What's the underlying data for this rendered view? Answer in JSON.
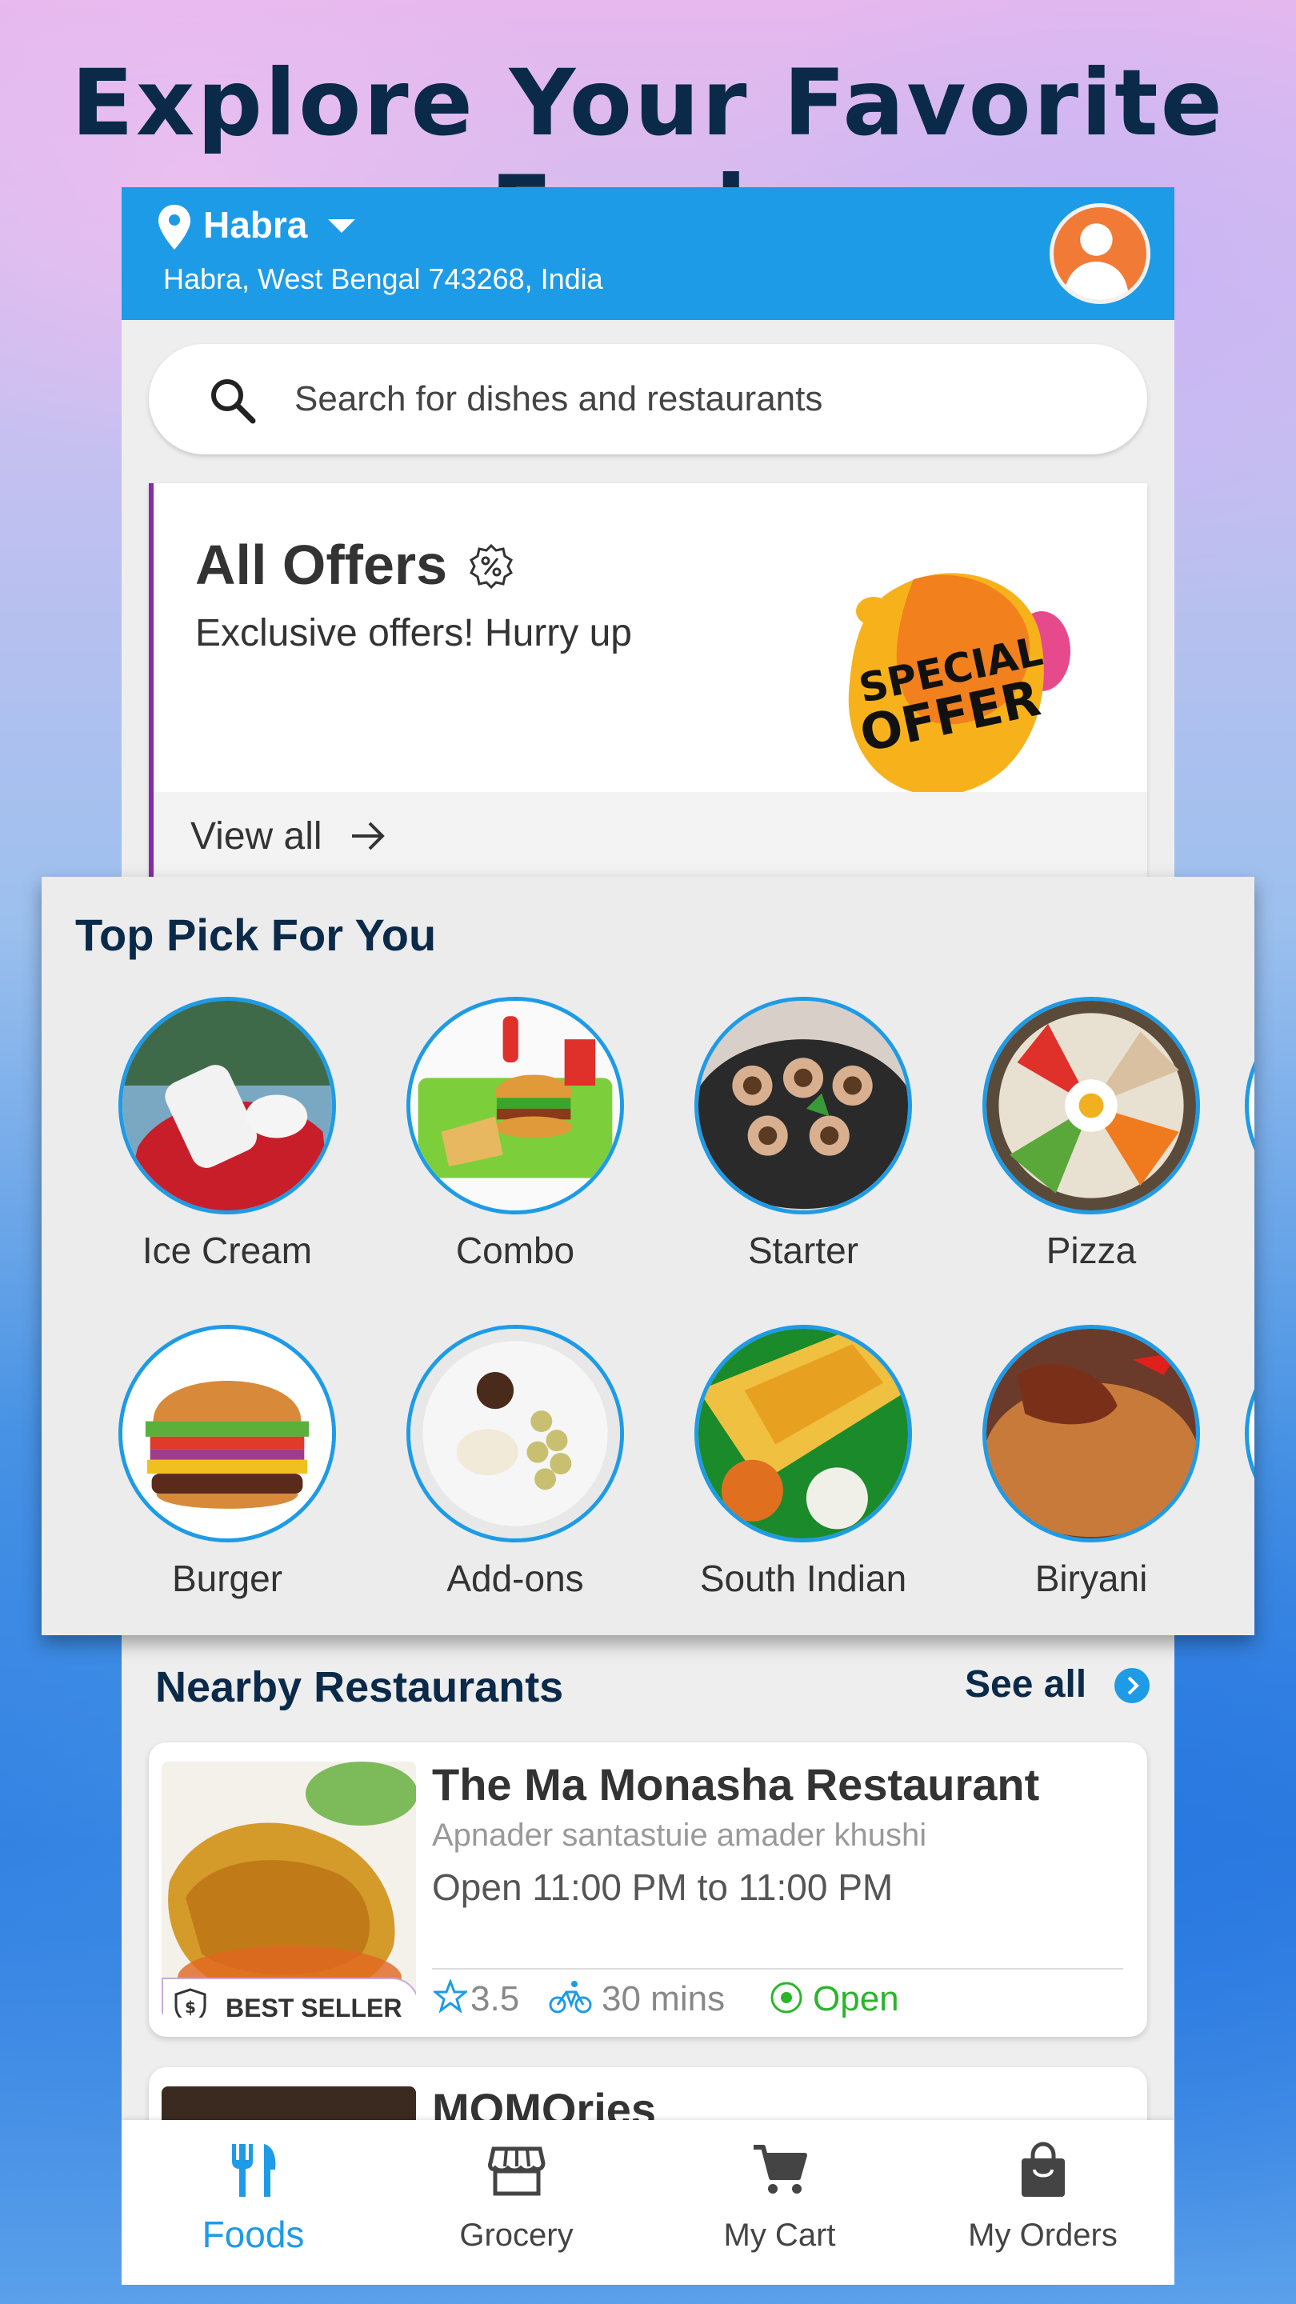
{
  "headline": "Explore Your Favorite Foods",
  "location": {
    "city": "Habra",
    "address": "Habra, West Bengal 743268, India"
  },
  "search": {
    "placeholder": "Search for dishes and restaurants"
  },
  "offers": {
    "title": "All Offers",
    "subtitle": "Exclusive offers! Hurry up",
    "badge_text_line1": "SPECIAL",
    "badge_text_line2": "OFFER",
    "view_all": "View all"
  },
  "top_pick": {
    "title": "Top Pick For You",
    "categories": [
      {
        "label": "Ice Cream"
      },
      {
        "label": "Combo"
      },
      {
        "label": "Starter"
      },
      {
        "label": "Pizza"
      },
      {
        "label": "Burger"
      },
      {
        "label": "Add-ons"
      },
      {
        "label": "South Indian"
      },
      {
        "label": "Biryani"
      }
    ]
  },
  "nearby": {
    "title": "Nearby Restaurants",
    "see_all": "See all",
    "restaurants": [
      {
        "name": "The Ma Monasha Restaurant",
        "tagline": "Apnader santastuie amader khushi",
        "hours": "Open 11:00 PM to 11:00 PM",
        "badge": "BEST SELLER",
        "rating": "3.5",
        "eta": "30 mins",
        "status": "Open"
      },
      {
        "name": "MOMOries"
      }
    ]
  },
  "bottom_nav": [
    {
      "label": "Foods",
      "icon": "fork-knife-icon",
      "active": true
    },
    {
      "label": "Grocery",
      "icon": "store-icon",
      "active": false
    },
    {
      "label": "My Cart",
      "icon": "cart-icon",
      "active": false
    },
    {
      "label": "My Orders",
      "icon": "bag-icon",
      "active": false
    }
  ],
  "colors": {
    "primary": "#1e9be6",
    "heading": "#0b2a4a",
    "open_green": "#2bb52b",
    "avatar": "#f07a36"
  }
}
